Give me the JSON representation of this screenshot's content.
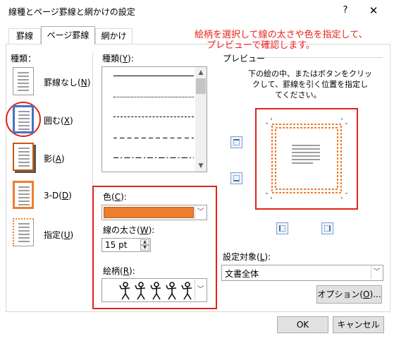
{
  "window": {
    "title": "線種とページ罫線と網かけの設定",
    "help_label": "?",
    "close_label": "✕"
  },
  "tabs": [
    {
      "label": "罫線",
      "active": false
    },
    {
      "label": "ページ罫線",
      "active": true
    },
    {
      "label": "網かけ",
      "active": false
    }
  ],
  "annotation": {
    "line1": "絵柄を選択して線の太さや色を指定して、",
    "line2": "プレビューで確認します。",
    "color": "#e8211b"
  },
  "setting": {
    "heading": "種類：",
    "items": [
      {
        "label_text": "罫線なし",
        "shortcut": "N",
        "icon": "no-border-icon"
      },
      {
        "label_text": "囲む",
        "shortcut": "X",
        "icon": "box-border-icon",
        "selected": true
      },
      {
        "label_text": "影",
        "shortcut": "A",
        "icon": "shadow-border-icon"
      },
      {
        "label_text": "3-D",
        "shortcut": "D",
        "icon": "3d-border-icon"
      },
      {
        "label_text": "指定",
        "shortcut": "U",
        "icon": "custom-border-icon"
      }
    ]
  },
  "style": {
    "heading_text": "種類",
    "shortcut": "Y",
    "colon": ":",
    "lines": [
      "solid",
      "dotted",
      "dashed-small",
      "dashed",
      "dash-dot"
    ]
  },
  "color": {
    "heading_text": "色",
    "shortcut": "C",
    "colon": ":",
    "value": "#ed7d31"
  },
  "width": {
    "heading_text": "線の太さ",
    "shortcut": "W",
    "colon": ":",
    "value": "15 pt"
  },
  "art": {
    "heading_text": "絵柄",
    "shortcut": "R",
    "colon": ":",
    "preview_glyphs": "🯅🯅🯅🯅🯅"
  },
  "preview": {
    "heading": "プレビュー",
    "instructions": [
      "下の絵の中、またはボタンをクリッ",
      "クして、罫線を引く位置を指定し",
      "てください。"
    ]
  },
  "apply_to": {
    "heading_text": "設定対象",
    "shortcut": "L",
    "colon": ":",
    "value": "文書全体"
  },
  "buttons": {
    "options_text": "オプション",
    "options_shortcut": "O",
    "options_suffix": "...",
    "ok": "OK",
    "cancel": "キャンセル"
  }
}
